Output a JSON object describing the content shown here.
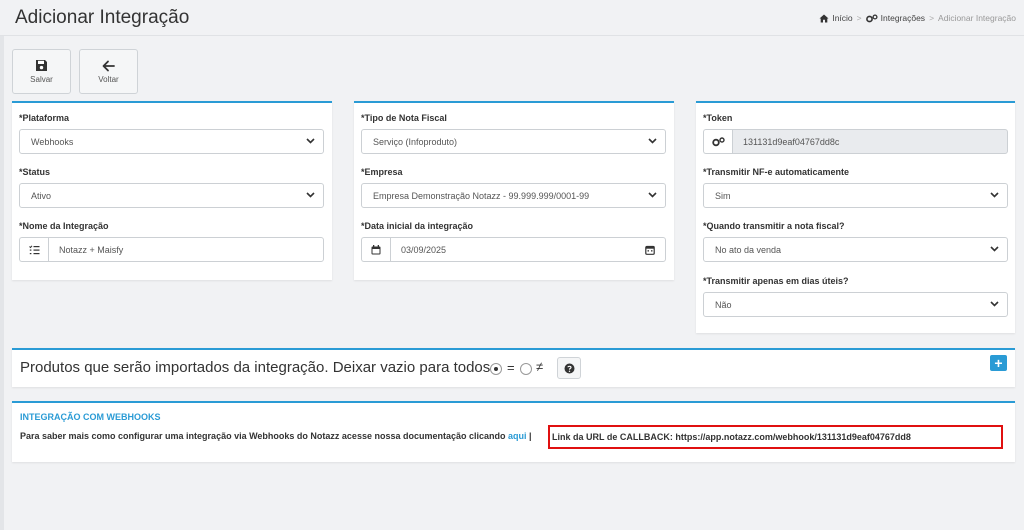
{
  "header": {
    "title": "Adicionar Integração",
    "breadcrumb": {
      "home": "Início",
      "integrations": "Integrações",
      "current": "Adicionar Integração",
      "separator": ">"
    }
  },
  "toolbar": {
    "save_label": "Salvar",
    "back_label": "Voltar"
  },
  "col1": {
    "platform_label": "*Plataforma",
    "platform_value": "Webhooks",
    "status_label": "*Status",
    "status_value": "Ativo",
    "name_label": "*Nome da Integração",
    "name_value": "Notazz + Maisfy"
  },
  "col2": {
    "invoice_type_label": "*Tipo de Nota Fiscal",
    "invoice_type_value": "Serviço (Infoproduto)",
    "company_label": "*Empresa",
    "company_value": "Empresa Demonstração Notazz - 99.999.999/0001-99",
    "start_date_label": "*Data inicial da integração",
    "start_date_value": "03/09/2025"
  },
  "col3": {
    "token_label": "*Token",
    "token_value": "131131d9eaf04767dd8c",
    "auto_transmit_label": "*Transmitir NF-e automaticamente",
    "auto_transmit_value": "Sim",
    "when_label": "*Quando transmitir a nota fiscal?",
    "when_value": "No ato da venda",
    "business_days_label": "*Transmitir apenas em dias úteis?",
    "business_days_value": "Não"
  },
  "products": {
    "text": "Produtos que serão importados da integração. Deixar vazio para todos.",
    "equal_symbol": "=",
    "not_equal_symbol": "≠",
    "selected": "equal",
    "add_symbol": "+"
  },
  "webhooks": {
    "title": "INTEGRAÇÃO COM WEBHOOKS",
    "info_text": "Para saber mais como configurar uma integração via Webhooks do Notazz acesse nossa documentação clicando",
    "link_text": "aqui",
    "divider": "|",
    "callback_text": "Link da URL de CALLBACK: https://app.notazz.com/webhook/131131d9eaf04767dd8"
  },
  "colors": {
    "accent": "#2a9bd5",
    "highlight_border": "#e01010"
  }
}
